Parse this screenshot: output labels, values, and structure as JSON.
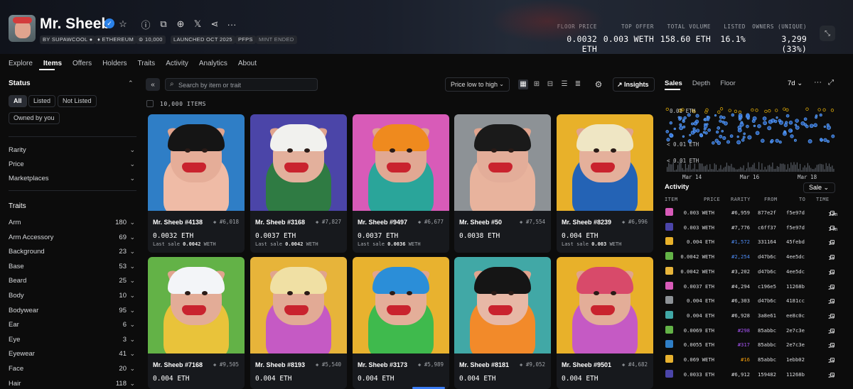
{
  "collection": {
    "title": "Mr. Sheeb",
    "tags": [
      "BY SUPAWCOOL",
      "ETHEREUM",
      "10,000",
      "LAUNCHED OCT 2025",
      "PFPS",
      "MINT ENDED"
    ],
    "stats": [
      {
        "label": "FLOOR PRICE",
        "value": "0.0032 ETH"
      },
      {
        "label": "TOP OFFER",
        "value": "0.003 WETH"
      },
      {
        "label": "TOTAL VOLUME",
        "value": "158.60 ETH"
      },
      {
        "label": "LISTED",
        "value": "16.1%"
      },
      {
        "label": "OWNERS (UNIQUE)",
        "value": "3,299 (33%)"
      }
    ]
  },
  "tabs": [
    "Explore",
    "Items",
    "Offers",
    "Holders",
    "Traits",
    "Activity",
    "Analytics",
    "About"
  ],
  "sidebar": {
    "status_title": "Status",
    "status_pills": [
      "All",
      "Listed",
      "Not Listed",
      "Owned by you"
    ],
    "filters": [
      "Rarity",
      "Price",
      "Marketplaces"
    ],
    "traits_title": "Traits",
    "traits": [
      {
        "name": "Arm",
        "count": "180"
      },
      {
        "name": "Arm Accessory",
        "count": "69"
      },
      {
        "name": "Background",
        "count": "23"
      },
      {
        "name": "Base",
        "count": "53"
      },
      {
        "name": "Beard",
        "count": "25"
      },
      {
        "name": "Body",
        "count": "10"
      },
      {
        "name": "Bodywear",
        "count": "95"
      },
      {
        "name": "Ear",
        "count": "6"
      },
      {
        "name": "Eye",
        "count": "3"
      },
      {
        "name": "Eyewear",
        "count": "41"
      },
      {
        "name": "Face",
        "count": "20"
      },
      {
        "name": "Hair",
        "count": "118"
      }
    ]
  },
  "toolbar": {
    "search_placeholder": "Search by item or trait",
    "sort": "Price low to high",
    "insights": "Insights",
    "items_count": "10,000 ITEMS"
  },
  "cards": [
    {
      "name": "Mr. Sheeb #4138",
      "rank": "#6,018",
      "price": "0.0032 ETH",
      "last_sale": "0.0042",
      "last_unit": "WETH",
      "bg": "#2f7ec6",
      "head": "#e5ad98",
      "hair": "#151515",
      "body": "#efbba6"
    },
    {
      "name": "Mr. Sheeb #3168",
      "rank": "#7,827",
      "price": "0.0037 ETH",
      "last_sale": "0.0042",
      "last_unit": "WETH",
      "bg": "#4b45a8",
      "head": "#e3b09c",
      "hair": "#f1f1ee",
      "body": "#2f7b43"
    },
    {
      "name": "Mr. Sheeb #9497",
      "rank": "#6,677",
      "price": "0.0037 ETH",
      "last_sale": "0.0036",
      "last_unit": "WETH",
      "bg": "#d85bb8",
      "head": "#e1a893",
      "hair": "#ef8a1e",
      "body": "#2aa59a"
    },
    {
      "name": "Mr. Sheeb #50",
      "rank": "#7,554",
      "price": "0.0038 ETH",
      "last_sale": "",
      "last_unit": "",
      "bg": "#8d9296",
      "head": "#e3ad99",
      "hair": "#1a1a1a",
      "body": "#e8b39d"
    },
    {
      "name": "Mr. Sheeb #8239",
      "rank": "#6,996",
      "price": "0.004 ETH",
      "last_sale": "0.003",
      "last_unit": "WETH",
      "bg": "#e8b12a",
      "head": "#e4b09b",
      "hair": "#efe6c4",
      "body": "#2463b5"
    },
    {
      "name": "Mr. Sheeb #7168",
      "rank": "#9,505",
      "price": "0.004 ETH",
      "last_sale": "",
      "last_unit": "",
      "bg": "#63b247",
      "head": "#e3ac97",
      "hair": "#f3f5f8",
      "body": "#e9c33a"
    },
    {
      "name": "Mr. Sheeb #8193",
      "rank": "#5,540",
      "price": "0.004 ETH",
      "last_sale": "",
      "last_unit": "",
      "bg": "#e7b43a",
      "head": "#e2aa95",
      "hair": "#f0e0a4",
      "body": "#c55ac4"
    },
    {
      "name": "Mr. Sheeb #3173",
      "rank": "#5,989",
      "price": "0.004 ETH",
      "last_sale": "",
      "last_unit": "",
      "bg": "#e8b22f",
      "head": "#e4ae99",
      "hair": "#2b8ed8",
      "body": "#3fba4d"
    },
    {
      "name": "Mr. Sheeb #8181",
      "rank": "#9,052",
      "price": "0.004 ETH",
      "last_sale": "",
      "last_unit": "",
      "bg": "#41a8a6",
      "head": "#e7b8a6",
      "hair": "#151515",
      "body": "#f28a2a"
    },
    {
      "name": "Mr. Sheeb #9501",
      "rank": "#4,682",
      "price": "0.004 ETH",
      "last_sale": "",
      "last_unit": "",
      "bg": "#e8b12a",
      "head": "#e3ad98",
      "hair": "#d84a6a",
      "body": "#c55ac4"
    }
  ],
  "right_panel": {
    "tabs": [
      "Sales",
      "Depth",
      "Floor"
    ],
    "period": "7d",
    "chart_labels": [
      "0.01 ETH",
      "< 0.01 ETH",
      "< 0.01 ETH"
    ],
    "chart_dates": [
      "Mar 14",
      "Mar 16",
      "Mar 18"
    ],
    "activity_title": "Activity",
    "activity_filter": "Sale",
    "columns": [
      "ITEM",
      "PRICE",
      "RARITY",
      "FROM",
      "TO",
      "TIME"
    ],
    "rows": [
      {
        "price": "0.003 WETH",
        "rarity": "#6,959",
        "from": "877e2f",
        "to": "f5e97d",
        "time": "13m",
        "rarity_color": "#dcdde0",
        "thumb": "#d85bb8"
      },
      {
        "price": "0.003 WETH",
        "rarity": "#7,776",
        "from": "c6ff37",
        "to": "f5e97d",
        "time": "14m",
        "rarity_color": "#dcdde0",
        "thumb": "#4b45a8"
      },
      {
        "price": "0.004 ETH",
        "rarity": "#1,572",
        "from": "331164",
        "to": "45febd",
        "time": "1h",
        "rarity_color": "#4e8cf5",
        "thumb": "#e8b12a"
      },
      {
        "price": "0.0042 WETH",
        "rarity": "#2,254",
        "from": "d47b6c",
        "to": "4ee5dc",
        "time": "1h",
        "rarity_color": "#4e8cf5",
        "thumb": "#63b247"
      },
      {
        "price": "0.0042 WETH",
        "rarity": "#3,202",
        "from": "d47b6c",
        "to": "4ee5dc",
        "time": "1h",
        "rarity_color": "#dcdde0",
        "thumb": "#e7b43a"
      },
      {
        "price": "0.0037 ETH",
        "rarity": "#4,294",
        "from": "c196e5",
        "to": "11268b",
        "time": "2h",
        "rarity_color": "#dcdde0",
        "thumb": "#d85bb8"
      },
      {
        "price": "0.004 ETH",
        "rarity": "#6,303",
        "from": "d47b6c",
        "to": "4181cc",
        "time": "2h",
        "rarity_color": "#dcdde0",
        "thumb": "#8d9296"
      },
      {
        "price": "0.004 ETH",
        "rarity": "#6,928",
        "from": "3a8e61",
        "to": "ee8c0c",
        "time": "2h",
        "rarity_color": "#dcdde0",
        "thumb": "#41a8a6"
      },
      {
        "price": "0.0069 ETH",
        "rarity": "#298",
        "from": "85abbc",
        "to": "2e7c3e",
        "time": "2h",
        "rarity_color": "#a855f7",
        "thumb": "#63b247"
      },
      {
        "price": "0.0055 ETH",
        "rarity": "#317",
        "from": "85abbc",
        "to": "2e7c3e",
        "time": "2h",
        "rarity_color": "#a855f7",
        "thumb": "#2f7ec6"
      },
      {
        "price": "0.069 WETH",
        "rarity": "#16",
        "from": "85abbc",
        "to": "1ebb02",
        "time": "2h",
        "rarity_color": "#f59e0b",
        "thumb": "#e8b22f"
      },
      {
        "price": "0.0033 ETH",
        "rarity": "#6,912",
        "from": "159482",
        "to": "11268b",
        "time": "2h",
        "rarity_color": "#dcdde0",
        "thumb": "#4b45a8"
      }
    ]
  },
  "colors": {
    "accent": "#2a81e8",
    "background": "#0c0c0c",
    "card": "#17191d"
  }
}
